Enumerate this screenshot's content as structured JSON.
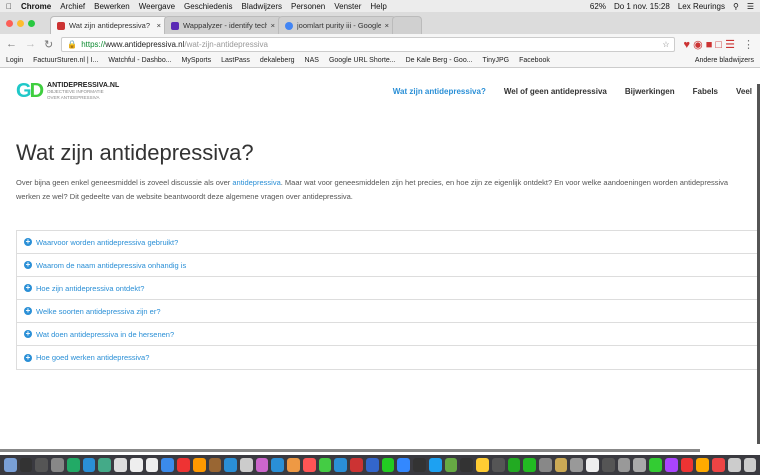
{
  "menubar": {
    "app": "Chrome",
    "items": [
      "Archief",
      "Bewerken",
      "Weergave",
      "Geschiedenis",
      "Bladwijzers",
      "Personen",
      "Venster",
      "Help"
    ],
    "battery": "62%",
    "datetime": "Do 1 nov.  15:28",
    "user": "Lex Reurings"
  },
  "tabs": [
    {
      "title": "Wat zijn antidepressiva?",
      "color": "#c33"
    },
    {
      "title": "Wappalyzer - identify technolo",
      "color": "#5a2ab5"
    },
    {
      "title": "joomlart purity iii - Google zoe",
      "color": "#4285f4"
    }
  ],
  "address": {
    "scheme": "https://",
    "host": "www.antidepressiva.nl",
    "path": "/wat-zijn-antidepressiva"
  },
  "bookmarks": [
    "Login",
    "FactuurSturen.nl | I...",
    "Watchful - Dashbo...",
    "MySports",
    "LastPass",
    "dekaleberg",
    "NAS",
    "Google URL Shorte...",
    "De Kale Berg - Goo...",
    "TinyJPG",
    "Facebook"
  ],
  "bookmarks_other": "Andere bladwijzers",
  "site": {
    "logo_mark": "GD",
    "logo_name": "ANTIDEPRESSIVA.NL",
    "logo_sub": "OBJECTIEVE INFORMATIE OVER ANTIDEPRESSIVA",
    "nav": [
      "Wat zijn antidepressiva?",
      "Wel of geen antidepressiva",
      "Bijwerkingen",
      "Fabels",
      "Veel"
    ],
    "title": "Wat zijn antidepressiva?",
    "intro_1a": "Over bijna geen enkel geneesmiddel is zoveel discussie als over ",
    "intro_link": "antidepressiva",
    "intro_1b": ". Maar wat voor geneesmiddelen zijn het precies, en hoe zijn ze eigenlijk ontdekt? En voor welke aandoeningen worden antidepressiva",
    "intro_2": "werken ze wel? Dit gedeelte van de website beantwoordt deze algemene vragen over antidepressiva.",
    "faq": [
      "Waarvoor worden antidepressiva gebruikt?",
      "Waarom de naam antidepressiva onhandig is",
      "Hoe zijn antidepressiva ontdekt?",
      "Welke soorten antidepressiva zijn er?",
      "Wat doen antidepressiva in de hersenen?",
      "Hoe goed werken antidepressiva?"
    ]
  },
  "accent": "#2a8fd6"
}
